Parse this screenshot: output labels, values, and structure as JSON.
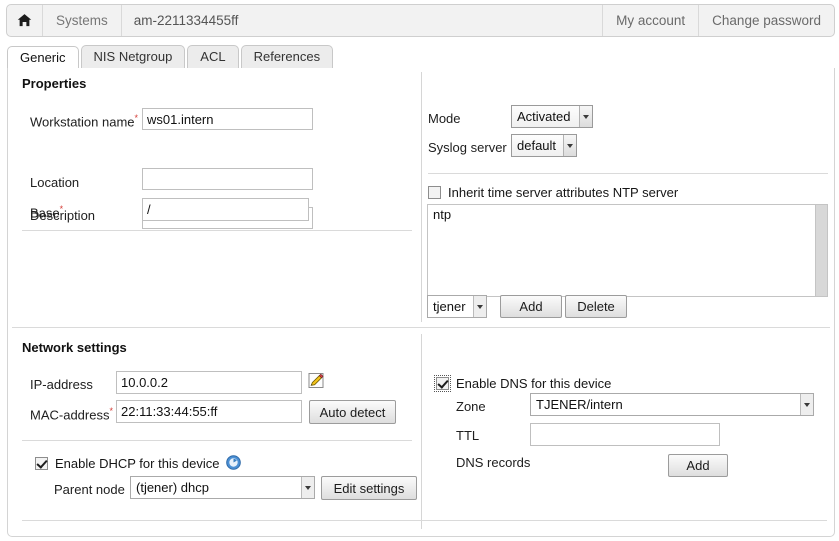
{
  "topbar": {
    "home_icon": "home-icon",
    "systems_label": "Systems",
    "page_title": "am-2211334455ff",
    "my_account": "My account",
    "change_password": "Change password"
  },
  "tabs": [
    {
      "label": "Generic",
      "active": true
    },
    {
      "label": "NIS Netgroup",
      "active": false
    },
    {
      "label": "ACL",
      "active": false
    },
    {
      "label": "References",
      "active": false
    }
  ],
  "properties": {
    "section_title": "Properties",
    "workstation_name": {
      "label": "Workstation name",
      "required": "*",
      "value": "ws01.intern"
    },
    "description": {
      "label": "Description",
      "value": ""
    },
    "location": {
      "label": "Location",
      "value": ""
    },
    "base": {
      "label": "Base",
      "required": "*",
      "value": "/"
    },
    "mode": {
      "label": "Mode",
      "value": "Activated"
    },
    "syslog_server": {
      "label": "Syslog server",
      "value": "default"
    },
    "inherit_ntp": {
      "label": "Inherit time server attributes NTP server",
      "checked": false
    },
    "ntp_servers": [
      "ntp"
    ],
    "ntp_select": "tjener",
    "ntp_add": "Add",
    "ntp_delete": "Delete"
  },
  "network": {
    "section_title": "Network settings",
    "ip_address": {
      "label": "IP-address",
      "value": "10.0.0.2",
      "edit_icon": "pencil-edit-icon"
    },
    "mac_address": {
      "label": "MAC-address",
      "required": "*",
      "value": "22:11:33:44:55:ff"
    },
    "auto_detect": "Auto detect",
    "dhcp": {
      "label": "Enable DHCP for this device",
      "checked": true,
      "info_icon": "info-icon",
      "parent_node_label": "Parent node",
      "parent_node_value": "(tjener) dhcp",
      "edit_settings": "Edit settings"
    },
    "dns": {
      "label": "Enable DNS for this device",
      "checked": true,
      "zone_label": "Zone",
      "zone_value": "TJENER/intern",
      "ttl_label": "TTL",
      "ttl_value": "",
      "records_label": "DNS records",
      "add_label": "Add"
    }
  },
  "colors": {
    "required_marker": "#d43b35",
    "panel_border": "#d4d4d4",
    "accent_blue": "#3a7fc1"
  }
}
